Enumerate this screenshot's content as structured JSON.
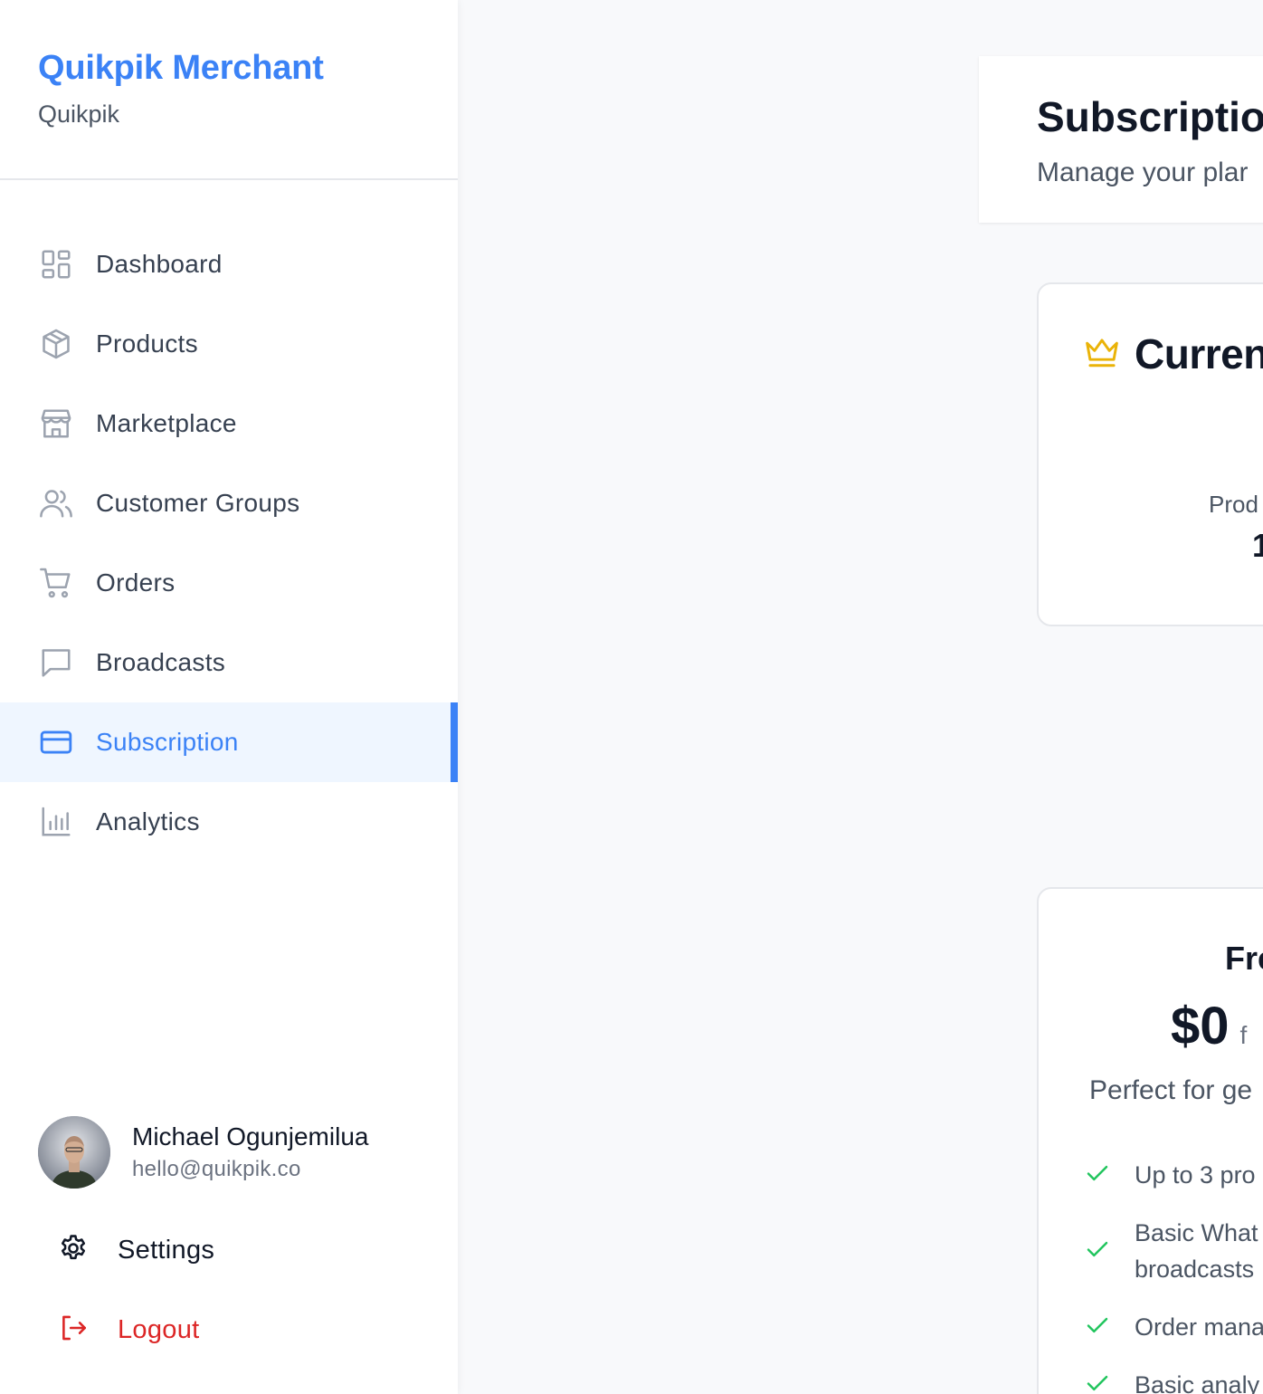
{
  "sidebar": {
    "brand_title": "Quikpik Merchant",
    "brand_subtitle": "Quikpik",
    "items": [
      {
        "label": "Dashboard",
        "icon": "dashboard-icon"
      },
      {
        "label": "Products",
        "icon": "package-icon"
      },
      {
        "label": "Marketplace",
        "icon": "store-icon"
      },
      {
        "label": "Customer Groups",
        "icon": "users-icon"
      },
      {
        "label": "Orders",
        "icon": "cart-icon"
      },
      {
        "label": "Broadcasts",
        "icon": "message-icon"
      },
      {
        "label": "Subscription",
        "icon": "credit-card-icon",
        "active": true
      },
      {
        "label": "Analytics",
        "icon": "bar-chart-icon"
      }
    ],
    "active_color": "#3b82f6",
    "user": {
      "name": "Michael Ogunjemilua",
      "email": "hello@quikpik.co"
    },
    "settings_label": "Settings",
    "logout_label": "Logout",
    "logout_color": "#dc2626"
  },
  "header": {
    "title": "Subscriptio",
    "subtitle": "Manage your plar"
  },
  "current_plan": {
    "title": "Curren",
    "icon": "crown-icon",
    "icon_color": "#eab308",
    "stat_label": "Prod",
    "stat_value": "1"
  },
  "plan": {
    "name": "Fre",
    "price": "$0",
    "period": "f",
    "description": "Perfect for ge",
    "check_color": "#22c55e",
    "features": [
      "Up to 3 pro",
      "Basic What",
      "broadcasts",
      "Order mana",
      "Basic analy"
    ]
  }
}
